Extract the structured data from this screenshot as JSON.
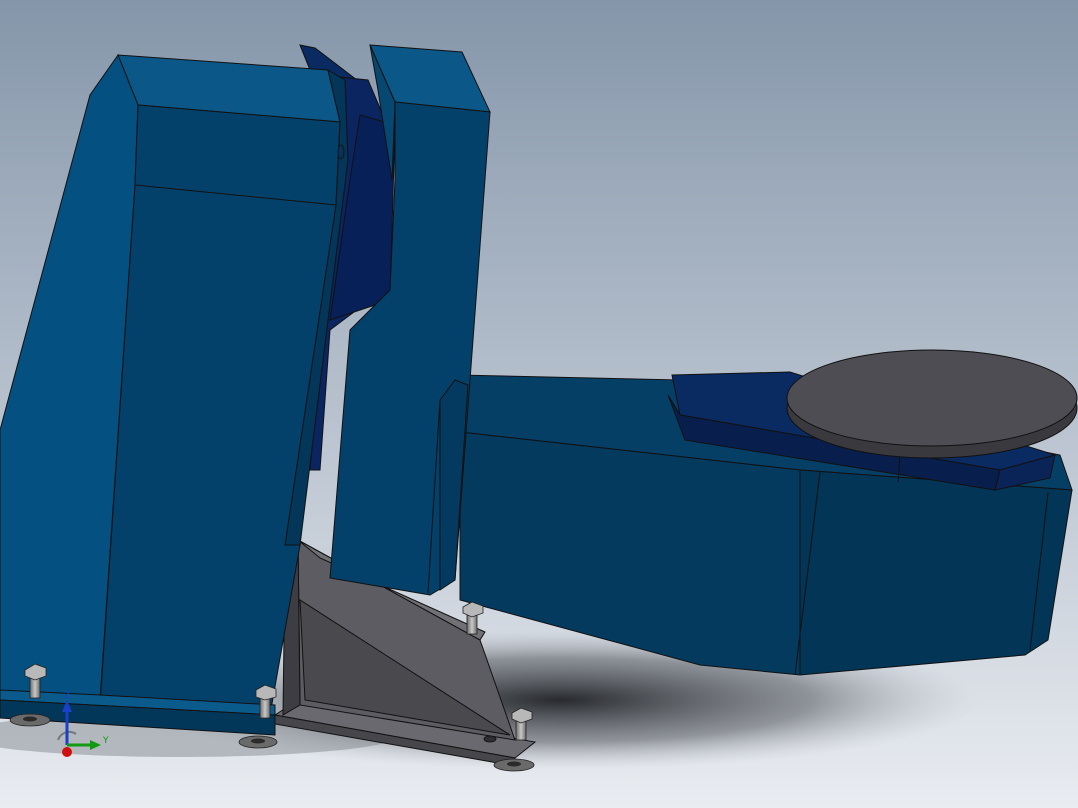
{
  "viewport": {
    "background_top": "#8596aa",
    "background_bottom": "#e9ecf1",
    "model_colors": {
      "body_blue": "#034168",
      "body_blue_light": "#0a5a8c",
      "body_blue_dark": "#022a48",
      "accent_navy": "#0a2560",
      "steel_gray": "#5b5a60",
      "steel_gray_dark": "#3f3e44",
      "turntable_top": "#4d4c52",
      "bolt_gray": "#9a9a9a"
    }
  },
  "triad": {
    "x_axis_color": "#d01010",
    "y_axis_color": "#129a12",
    "z_axis_color": "#1a3fc8",
    "x_label": "",
    "y_label": "Y",
    "z_label": "Z"
  }
}
